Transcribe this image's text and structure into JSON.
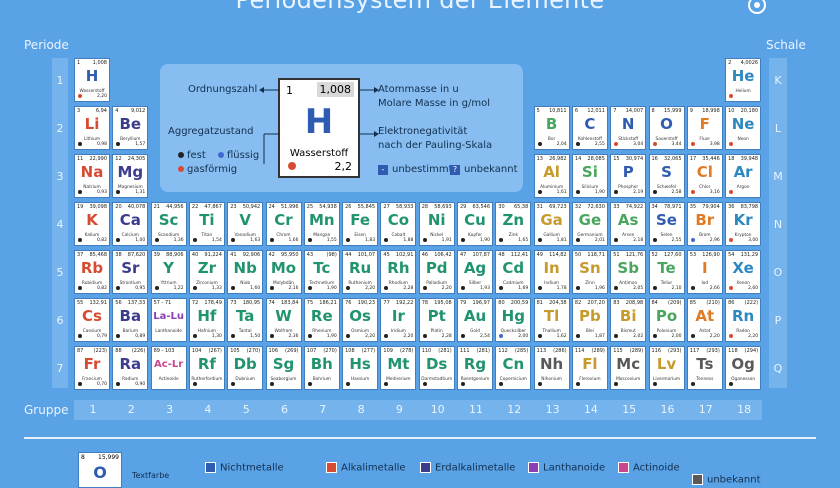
{
  "header": {
    "title": "Periodensystem der Elemente"
  },
  "labels": {
    "periode": "Periode",
    "schale": "Schale",
    "gruppe": "Gruppe"
  },
  "periods": [
    "1",
    "2",
    "3",
    "4",
    "5",
    "6",
    "7"
  ],
  "shells": [
    "K",
    "L",
    "M",
    "N",
    "O",
    "P",
    "Q"
  ],
  "groups": [
    "1",
    "2",
    "3",
    "4",
    "5",
    "6",
    "7",
    "8",
    "9",
    "10",
    "11",
    "12",
    "13",
    "14",
    "15",
    "16",
    "17",
    "18"
  ],
  "colors": {
    "Nichtmetalle": "#2f5bb0",
    "Alkalimetalle": "#d74b32",
    "Erdalkalimetalle": "#3c3b8c",
    "Lanthanoide": "#8a3fb5",
    "Actinoide": "#c9468f",
    "Uebergangsmetalle": "#20936f",
    "Halbmetalle": "#4aa65e",
    "Metalle": "#c79a2c",
    "Halogene": "#e17a23",
    "Edelgase": "#2d88c0",
    "unbekannt": "#595959"
  },
  "legend": {
    "ordnungszahl": "Ordnungszahl",
    "atommasse": "Atommasse in u",
    "molare_masse": "Molare Masse in g/mol",
    "aggregatzustand": "Aggregatzustand",
    "elektronegativitaet": "Elektronegativität",
    "pauling": "nach der Pauling-Skala",
    "fest": "fest",
    "fluessig": "flüssig",
    "gasfoermig": "gasförmig",
    "unbestimmt": "unbestimmt",
    "unbekannt": "unbekannt",
    "example": {
      "num": "1",
      "mass": "1,008",
      "sym": "H",
      "name": "Wasserstoff",
      "en": "2,2"
    }
  },
  "footer": {
    "example_num": "8",
    "example_mass": "15,999",
    "example_sym": "O",
    "textfarbe": "Textfarbe",
    "nichtmetalle": "Nichtmetalle",
    "alkalimetalle": "Alkalimetalle",
    "erdalkalimetalle": "Erdalkalimetalle",
    "lanthanoide": "Lanthanoide",
    "actinoide": "Actinoide",
    "unbekannt": "unbekannt"
  },
  "elements": [
    {
      "n": "1",
      "m": "1,008",
      "s": "H",
      "name": "Wasserstoff",
      "en": "2,20",
      "p": 1,
      "g": 1,
      "c": "Nichtmetalle",
      "st": "gas"
    },
    {
      "n": "2",
      "m": "4,0026",
      "s": "He",
      "name": "Helium",
      "en": "",
      "p": 1,
      "g": 18,
      "c": "Edelgase",
      "st": "gas"
    },
    {
      "n": "3",
      "m": "6,94",
      "s": "Li",
      "name": "Lithium",
      "en": "0,98",
      "p": 2,
      "g": 1,
      "c": "Alkalimetalle",
      "st": "fest"
    },
    {
      "n": "4",
      "m": "9,012",
      "s": "Be",
      "name": "Beryllium",
      "en": "1,57",
      "p": 2,
      "g": 2,
      "c": "Erdalkalimetalle",
      "st": "fest"
    },
    {
      "n": "5",
      "m": "10,811",
      "s": "B",
      "name": "Bor",
      "en": "2,04",
      "p": 2,
      "g": 13,
      "c": "Halbmetalle",
      "st": "fest"
    },
    {
      "n": "6",
      "m": "12,011",
      "s": "C",
      "name": "Kohlenstoff",
      "en": "2,55",
      "p": 2,
      "g": 14,
      "c": "Nichtmetalle",
      "st": "fest"
    },
    {
      "n": "7",
      "m": "14,007",
      "s": "N",
      "name": "Stickstoff",
      "en": "3,04",
      "p": 2,
      "g": 15,
      "c": "Nichtmetalle",
      "st": "gas"
    },
    {
      "n": "8",
      "m": "15,999",
      "s": "O",
      "name": "Sauerstoff",
      "en": "3,44",
      "p": 2,
      "g": 16,
      "c": "Nichtmetalle",
      "st": "gas"
    },
    {
      "n": "9",
      "m": "18,998",
      "s": "F",
      "name": "Fluor",
      "en": "3,98",
      "p": 2,
      "g": 17,
      "c": "Halogene",
      "st": "gas"
    },
    {
      "n": "10",
      "m": "20,180",
      "s": "Ne",
      "name": "Neon",
      "en": "",
      "p": 2,
      "g": 18,
      "c": "Edelgase",
      "st": "gas"
    },
    {
      "n": "11",
      "m": "22,990",
      "s": "Na",
      "name": "Natrium",
      "en": "0,93",
      "p": 3,
      "g": 1,
      "c": "Alkalimetalle",
      "st": "fest"
    },
    {
      "n": "12",
      "m": "24,305",
      "s": "Mg",
      "name": "Magnesium",
      "en": "1,31",
      "p": 3,
      "g": 2,
      "c": "Erdalkalimetalle",
      "st": "fest"
    },
    {
      "n": "13",
      "m": "26,982",
      "s": "Al",
      "name": "Aluminium",
      "en": "1,61",
      "p": 3,
      "g": 13,
      "c": "Metalle",
      "st": "fest"
    },
    {
      "n": "14",
      "m": "28,085",
      "s": "Si",
      "name": "Silicium",
      "en": "1,90",
      "p": 3,
      "g": 14,
      "c": "Halbmetalle",
      "st": "fest"
    },
    {
      "n": "15",
      "m": "30,974",
      "s": "P",
      "name": "Phosphor",
      "en": "2,19",
      "p": 3,
      "g": 15,
      "c": "Nichtmetalle",
      "st": "fest"
    },
    {
      "n": "16",
      "m": "32,065",
      "s": "S",
      "name": "Schwefel",
      "en": "2,58",
      "p": 3,
      "g": 16,
      "c": "Nichtmetalle",
      "st": "fest"
    },
    {
      "n": "17",
      "m": "35,446",
      "s": "Cl",
      "name": "Chlor",
      "en": "3,16",
      "p": 3,
      "g": 17,
      "c": "Halogene",
      "st": "gas"
    },
    {
      "n": "18",
      "m": "39,948",
      "s": "Ar",
      "name": "Argon",
      "en": "",
      "p": 3,
      "g": 18,
      "c": "Edelgase",
      "st": "gas"
    },
    {
      "n": "19",
      "m": "39,098",
      "s": "K",
      "name": "Kalium",
      "en": "0,82",
      "p": 4,
      "g": 1,
      "c": "Alkalimetalle",
      "st": "fest"
    },
    {
      "n": "20",
      "m": "40,078",
      "s": "Ca",
      "name": "Calcium",
      "en": "1,00",
      "p": 4,
      "g": 2,
      "c": "Erdalkalimetalle",
      "st": "fest"
    },
    {
      "n": "21",
      "m": "44,956",
      "s": "Sc",
      "name": "Scandium",
      "en": "1,36",
      "p": 4,
      "g": 3,
      "c": "Uebergangsmetalle",
      "st": "fest"
    },
    {
      "n": "22",
      "m": "47,867",
      "s": "Ti",
      "name": "Titan",
      "en": "1,54",
      "p": 4,
      "g": 4,
      "c": "Uebergangsmetalle",
      "st": "fest"
    },
    {
      "n": "23",
      "m": "50,942",
      "s": "V",
      "name": "Vanadium",
      "en": "1,63",
      "p": 4,
      "g": 5,
      "c": "Uebergangsmetalle",
      "st": "fest"
    },
    {
      "n": "24",
      "m": "51,996",
      "s": "Cr",
      "name": "Chrom",
      "en": "1,66",
      "p": 4,
      "g": 6,
      "c": "Uebergangsmetalle",
      "st": "fest"
    },
    {
      "n": "25",
      "m": "54,938",
      "s": "Mn",
      "name": "Mangan",
      "en": "1,55",
      "p": 4,
      "g": 7,
      "c": "Uebergangsmetalle",
      "st": "fest"
    },
    {
      "n": "26",
      "m": "55,845",
      "s": "Fe",
      "name": "Eisen",
      "en": "1,83",
      "p": 4,
      "g": 8,
      "c": "Uebergangsmetalle",
      "st": "fest"
    },
    {
      "n": "27",
      "m": "58,933",
      "s": "Co",
      "name": "Cobalt",
      "en": "1,88",
      "p": 4,
      "g": 9,
      "c": "Uebergangsmetalle",
      "st": "fest"
    },
    {
      "n": "28",
      "m": "58,693",
      "s": "Ni",
      "name": "Nickel",
      "en": "1,91",
      "p": 4,
      "g": 10,
      "c": "Uebergangsmetalle",
      "st": "fest"
    },
    {
      "n": "29",
      "m": "63,546",
      "s": "Cu",
      "name": "Kupfer",
      "en": "1,90",
      "p": 4,
      "g": 11,
      "c": "Uebergangsmetalle",
      "st": "fest"
    },
    {
      "n": "30",
      "m": "65,38",
      "s": "Zn",
      "name": "Zink",
      "en": "1,65",
      "p": 4,
      "g": 12,
      "c": "Uebergangsmetalle",
      "st": "fest"
    },
    {
      "n": "31",
      "m": "69,723",
      "s": "Ga",
      "name": "Gallium",
      "en": "1,81",
      "p": 4,
      "g": 13,
      "c": "Metalle",
      "st": "fest"
    },
    {
      "n": "32",
      "m": "72,630",
      "s": "Ge",
      "name": "Germanium",
      "en": "2,01",
      "p": 4,
      "g": 14,
      "c": "Halbmetalle",
      "st": "fest"
    },
    {
      "n": "33",
      "m": "74,922",
      "s": "As",
      "name": "Arsen",
      "en": "2,18",
      "p": 4,
      "g": 15,
      "c": "Halbmetalle",
      "st": "fest"
    },
    {
      "n": "34",
      "m": "78,971",
      "s": "Se",
      "name": "Selen",
      "en": "2,55",
      "p": 4,
      "g": 16,
      "c": "Nichtmetalle",
      "st": "fest"
    },
    {
      "n": "35",
      "m": "79,904",
      "s": "Br",
      "name": "Brom",
      "en": "2,96",
      "p": 4,
      "g": 17,
      "c": "Halogene",
      "st": "fluessig"
    },
    {
      "n": "36",
      "m": "83,798",
      "s": "Kr",
      "name": "Krypton",
      "en": "3,00",
      "p": 4,
      "g": 18,
      "c": "Edelgase",
      "st": "gas"
    },
    {
      "n": "37",
      "m": "85,468",
      "s": "Rb",
      "name": "Rubidium",
      "en": "0,82",
      "p": 5,
      "g": 1,
      "c": "Alkalimetalle",
      "st": "fest"
    },
    {
      "n": "38",
      "m": "87,620",
      "s": "Sr",
      "name": "Strontium",
      "en": "0,95",
      "p": 5,
      "g": 2,
      "c": "Erdalkalimetalle",
      "st": "fest"
    },
    {
      "n": "39",
      "m": "88,906",
      "s": "Y",
      "name": "Yttrium",
      "en": "1,22",
      "p": 5,
      "g": 3,
      "c": "Uebergangsmetalle",
      "st": "fest"
    },
    {
      "n": "40",
      "m": "91,224",
      "s": "Zr",
      "name": "Zirconium",
      "en": "1,33",
      "p": 5,
      "g": 4,
      "c": "Uebergangsmetalle",
      "st": "fest"
    },
    {
      "n": "41",
      "m": "92,906",
      "s": "Nb",
      "name": "Niob",
      "en": "1,60",
      "p": 5,
      "g": 5,
      "c": "Uebergangsmetalle",
      "st": "fest"
    },
    {
      "n": "42",
      "m": "95,950",
      "s": "Mo",
      "name": "Molybdän",
      "en": "2,16",
      "p": 5,
      "g": 6,
      "c": "Uebergangsmetalle",
      "st": "fest"
    },
    {
      "n": "43",
      "m": "(98)",
      "s": "Tc",
      "name": "Technetium",
      "en": "1,90",
      "p": 5,
      "g": 7,
      "c": "Uebergangsmetalle",
      "st": "fest"
    },
    {
      "n": "44",
      "m": "101,07",
      "s": "Ru",
      "name": "Ruthenium",
      "en": "2,20",
      "p": 5,
      "g": 8,
      "c": "Uebergangsmetalle",
      "st": "fest"
    },
    {
      "n": "45",
      "m": "102,91",
      "s": "Rh",
      "name": "Rhodium",
      "en": "2,28",
      "p": 5,
      "g": 9,
      "c": "Uebergangsmetalle",
      "st": "fest"
    },
    {
      "n": "46",
      "m": "106,42",
      "s": "Pd",
      "name": "Palladium",
      "en": "2,20",
      "p": 5,
      "g": 10,
      "c": "Uebergangsmetalle",
      "st": "fest"
    },
    {
      "n": "47",
      "m": "107,87",
      "s": "Ag",
      "name": "Silber",
      "en": "1,93",
      "p": 5,
      "g": 11,
      "c": "Uebergangsmetalle",
      "st": "fest"
    },
    {
      "n": "48",
      "m": "112,41",
      "s": "Cd",
      "name": "Cadmium",
      "en": "1,69",
      "p": 5,
      "g": 12,
      "c": "Uebergangsmetalle",
      "st": "fest"
    },
    {
      "n": "49",
      "m": "114,82",
      "s": "In",
      "name": "Indium",
      "en": "1,78",
      "p": 5,
      "g": 13,
      "c": "Metalle",
      "st": "fest"
    },
    {
      "n": "50",
      "m": "118,71",
      "s": "Sn",
      "name": "Zinn",
      "en": "1,96",
      "p": 5,
      "g": 14,
      "c": "Metalle",
      "st": "fest"
    },
    {
      "n": "51",
      "m": "121,76",
      "s": "Sb",
      "name": "Antimon",
      "en": "2,05",
      "p": 5,
      "g": 15,
      "c": "Halbmetalle",
      "st": "fest"
    },
    {
      "n": "52",
      "m": "127,60",
      "s": "Te",
      "name": "Tellur",
      "en": "2,10",
      "p": 5,
      "g": 16,
      "c": "Halbmetalle",
      "st": "fest"
    },
    {
      "n": "53",
      "m": "126,90",
      "s": "I",
      "name": "Iod",
      "en": "2,66",
      "p": 5,
      "g": 17,
      "c": "Halogene",
      "st": "fest"
    },
    {
      "n": "54",
      "m": "131,29",
      "s": "Xe",
      "name": "Xenon",
      "en": "2,60",
      "p": 5,
      "g": 18,
      "c": "Edelgase",
      "st": "gas"
    },
    {
      "n": "55",
      "m": "132,91",
      "s": "Cs",
      "name": "Caesium",
      "en": "0,79",
      "p": 6,
      "g": 1,
      "c": "Alkalimetalle",
      "st": "fest"
    },
    {
      "n": "56",
      "m": "137,33",
      "s": "Ba",
      "name": "Barium",
      "en": "0,89",
      "p": 6,
      "g": 2,
      "c": "Erdalkalimetalle",
      "st": "fest"
    },
    {
      "n": "57 - 71",
      "m": "",
      "s": "La-Lu",
      "name": "Lanthanoide",
      "en": "",
      "p": 6,
      "g": 3,
      "c": "Lanthanoide",
      "st": ""
    },
    {
      "n": "72",
      "m": "178,49",
      "s": "Hf",
      "name": "Hafnium",
      "en": "1,30",
      "p": 6,
      "g": 4,
      "c": "Uebergangsmetalle",
      "st": "fest"
    },
    {
      "n": "73",
      "m": "180,95",
      "s": "Ta",
      "name": "Tantal",
      "en": "1,50",
      "p": 6,
      "g": 5,
      "c": "Uebergangsmetalle",
      "st": "fest"
    },
    {
      "n": "74",
      "m": "183,84",
      "s": "W",
      "name": "Wolfram",
      "en": "2,36",
      "p": 6,
      "g": 6,
      "c": "Uebergangsmetalle",
      "st": "fest"
    },
    {
      "n": "75",
      "m": "186,21",
      "s": "Re",
      "name": "Rhenium",
      "en": "1,90",
      "p": 6,
      "g": 7,
      "c": "Uebergangsmetalle",
      "st": "fest"
    },
    {
      "n": "76",
      "m": "190,23",
      "s": "Os",
      "name": "Osmium",
      "en": "2,20",
      "p": 6,
      "g": 8,
      "c": "Uebergangsmetalle",
      "st": "fest"
    },
    {
      "n": "77",
      "m": "192,22",
      "s": "Ir",
      "name": "Iridium",
      "en": "2,20",
      "p": 6,
      "g": 9,
      "c": "Uebergangsmetalle",
      "st": "fest"
    },
    {
      "n": "78",
      "m": "195,08",
      "s": "Pt",
      "name": "Platin",
      "en": "2,28",
      "p": 6,
      "g": 10,
      "c": "Uebergangsmetalle",
      "st": "fest"
    },
    {
      "n": "79",
      "m": "196,97",
      "s": "Au",
      "name": "Gold",
      "en": "2,54",
      "p": 6,
      "g": 11,
      "c": "Uebergangsmetalle",
      "st": "fest"
    },
    {
      "n": "80",
      "m": "200,59",
      "s": "Hg",
      "name": "Quecksilber",
      "en": "2,00",
      "p": 6,
      "g": 12,
      "c": "Uebergangsmetalle",
      "st": "fluessig"
    },
    {
      "n": "81",
      "m": "204,38",
      "s": "Tl",
      "name": "Thallium",
      "en": "1,62",
      "p": 6,
      "g": 13,
      "c": "Metalle",
      "st": "fest"
    },
    {
      "n": "82",
      "m": "207,20",
      "s": "Pb",
      "name": "Blei",
      "en": "1,87",
      "p": 6,
      "g": 14,
      "c": "Metalle",
      "st": "fest"
    },
    {
      "n": "83",
      "m": "208,98",
      "s": "Bi",
      "name": "Bismut",
      "en": "2,02",
      "p": 6,
      "g": 15,
      "c": "Metalle",
      "st": "fest"
    },
    {
      "n": "84",
      "m": "(209)",
      "s": "Po",
      "name": "Polonium",
      "en": "2,00",
      "p": 6,
      "g": 16,
      "c": "Halbmetalle",
      "st": "fest"
    },
    {
      "n": "85",
      "m": "(210)",
      "s": "At",
      "name": "Astat",
      "en": "2,20",
      "p": 6,
      "g": 17,
      "c": "Halogene",
      "st": "fest"
    },
    {
      "n": "86",
      "m": "(222)",
      "s": "Rn",
      "name": "Radon",
      "en": "2,20",
      "p": 6,
      "g": 18,
      "c": "Edelgase",
      "st": "gas"
    },
    {
      "n": "87",
      "m": "(223)",
      "s": "Fr",
      "name": "Francium",
      "en": "0,70",
      "p": 7,
      "g": 1,
      "c": "Alkalimetalle",
      "st": "fest"
    },
    {
      "n": "88",
      "m": "(226)",
      "s": "Ra",
      "name": "Radium",
      "en": "0,90",
      "p": 7,
      "g": 2,
      "c": "Erdalkalimetalle",
      "st": "fest"
    },
    {
      "n": "89 - 103",
      "m": "",
      "s": "Ac-Lr",
      "name": "Actinoide",
      "en": "",
      "p": 7,
      "g": 3,
      "c": "Actinoide",
      "st": ""
    },
    {
      "n": "104",
      "m": "(267)",
      "s": "Rf",
      "name": "Rutherfordium",
      "en": "",
      "p": 7,
      "g": 4,
      "c": "Uebergangsmetalle",
      "st": "fest"
    },
    {
      "n": "105",
      "m": "(270)",
      "s": "Db",
      "name": "Dubnium",
      "en": "",
      "p": 7,
      "g": 5,
      "c": "Uebergangsmetalle",
      "st": "fest"
    },
    {
      "n": "106",
      "m": "(269)",
      "s": "Sg",
      "name": "Seaborgium",
      "en": "",
      "p": 7,
      "g": 6,
      "c": "Uebergangsmetalle",
      "st": "fest"
    },
    {
      "n": "107",
      "m": "(270)",
      "s": "Bh",
      "name": "Bohrium",
      "en": "",
      "p": 7,
      "g": 7,
      "c": "Uebergangsmetalle",
      "st": "fest"
    },
    {
      "n": "108",
      "m": "(277)",
      "s": "Hs",
      "name": "Hassium",
      "en": "",
      "p": 7,
      "g": 8,
      "c": "Uebergangsmetalle",
      "st": "fest"
    },
    {
      "n": "109",
      "m": "(278)",
      "s": "Mt",
      "name": "Meitnerium",
      "en": "",
      "p": 7,
      "g": 9,
      "c": "Uebergangsmetalle",
      "st": "fest"
    },
    {
      "n": "110",
      "m": "(281)",
      "s": "Ds",
      "name": "Darmstadtium",
      "en": "",
      "p": 7,
      "g": 10,
      "c": "Uebergangsmetalle",
      "st": "fest"
    },
    {
      "n": "111",
      "m": "(281)",
      "s": "Rg",
      "name": "Roentgenium",
      "en": "",
      "p": 7,
      "g": 11,
      "c": "Uebergangsmetalle",
      "st": "fest"
    },
    {
      "n": "112",
      "m": "(285)",
      "s": "Cn",
      "name": "Copernicium",
      "en": "",
      "p": 7,
      "g": 12,
      "c": "Uebergangsmetalle",
      "st": "fest"
    },
    {
      "n": "113",
      "m": "(286)",
      "s": "Nh",
      "name": "Nihonium",
      "en": "",
      "p": 7,
      "g": 13,
      "c": "unbekannt",
      "st": "fest"
    },
    {
      "n": "114",
      "m": "(289)",
      "s": "Fl",
      "name": "Flerovium",
      "en": "",
      "p": 7,
      "g": 14,
      "c": "Metalle",
      "st": "fest"
    },
    {
      "n": "115",
      "m": "(289)",
      "s": "Mc",
      "name": "Moscovium",
      "en": "",
      "p": 7,
      "g": 15,
      "c": "unbekannt",
      "st": "fest"
    },
    {
      "n": "116",
      "m": "(293)",
      "s": "Lv",
      "name": "Livermorium",
      "en": "",
      "p": 7,
      "g": 16,
      "c": "Metalle",
      "st": "fest"
    },
    {
      "n": "117",
      "m": "(293)",
      "s": "Ts",
      "name": "Tenness",
      "en": "",
      "p": 7,
      "g": 17,
      "c": "unbekannt",
      "st": "fest"
    },
    {
      "n": "118",
      "m": "(294)",
      "s": "Og",
      "name": "Oganesson",
      "en": "",
      "p": 7,
      "g": 18,
      "c": "unbekannt",
      "st": "fest"
    }
  ]
}
